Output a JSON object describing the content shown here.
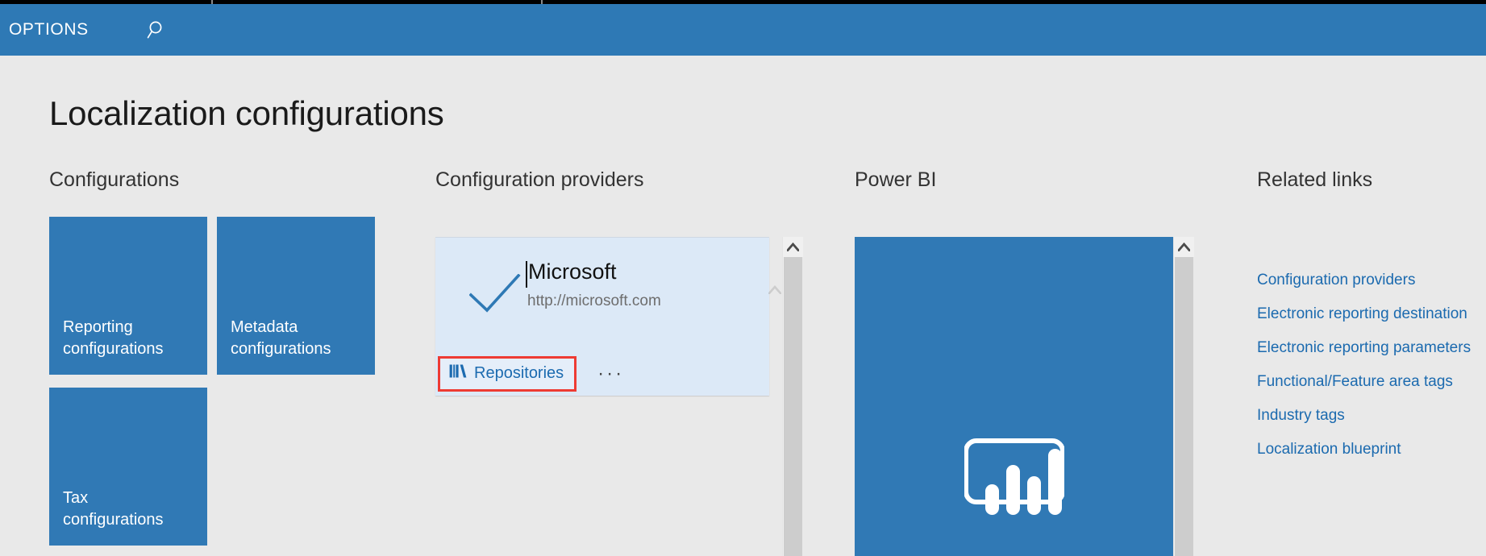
{
  "topbar": {
    "options_label": "OPTIONS",
    "search_icon": "search-icon"
  },
  "page": {
    "title": "Localization configurations"
  },
  "sections": {
    "configurations": "Configurations",
    "providers": "Configuration providers",
    "powerbi": "Power BI",
    "related": "Related links"
  },
  "tiles": [
    {
      "label": "Reporting\nconfigurations"
    },
    {
      "label": "Metadata\nconfigurations"
    },
    {
      "label": "Tax\nconfigurations"
    }
  ],
  "provider_card": {
    "name": "Microsoft",
    "url": "http://microsoft.com",
    "selected_icon": "checkmark-icon",
    "repositories_label": "Repositories",
    "repositories_icon": "books-icon",
    "more_label": "···"
  },
  "powerbi": {
    "logo_icon": "power-bi-logo-icon"
  },
  "related_links": [
    {
      "label": "Configuration providers"
    },
    {
      "label": "Electronic reporting destination"
    },
    {
      "label": "Electronic reporting parameters"
    },
    {
      "label": "Functional/Feature area tags"
    },
    {
      "label": "Industry tags"
    },
    {
      "label": "Localization blueprint"
    }
  ],
  "colors": {
    "header_blue": "#2E79B5",
    "tile_blue": "#3079B5",
    "card_light_blue": "#DCE9F7",
    "link_blue": "#1B6AAF",
    "highlight_red": "#EE3B33",
    "page_background": "#E9E9E9"
  }
}
